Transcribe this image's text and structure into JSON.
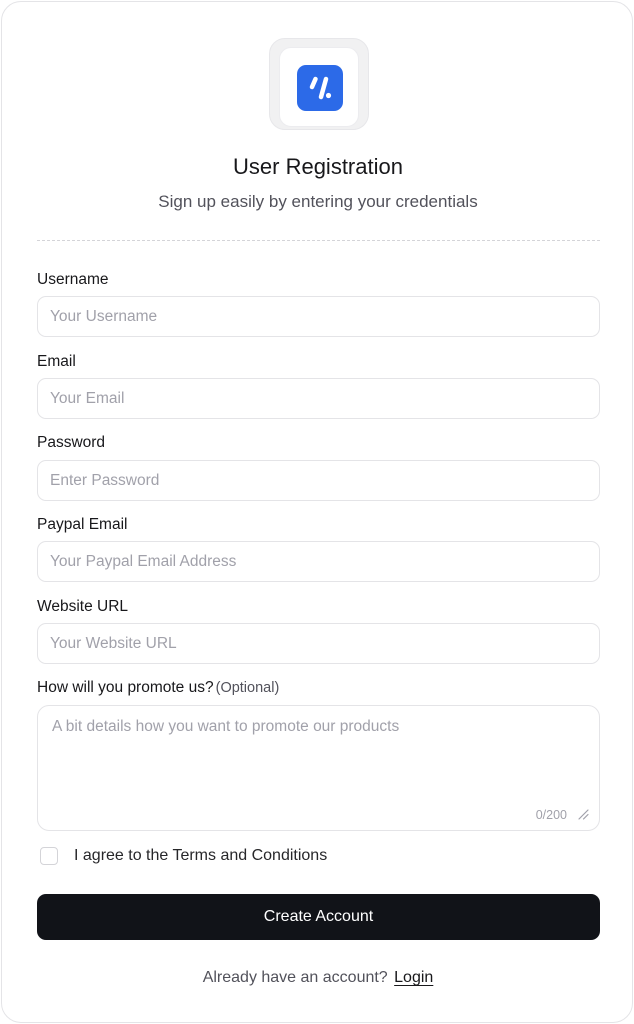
{
  "header": {
    "logo_icon": "brand-logo-icon",
    "brand_color": "#2c6ae8",
    "title": "User Registration",
    "subtitle": "Sign up easily by entering your credentials"
  },
  "form": {
    "username": {
      "label": "Username",
      "placeholder": "Your Username",
      "value": ""
    },
    "email": {
      "label": "Email",
      "placeholder": "Your Email",
      "value": ""
    },
    "password": {
      "label": "Password",
      "placeholder": "Enter Password",
      "value": ""
    },
    "paypal_email": {
      "label": "Paypal Email",
      "placeholder": "Your Paypal Email Address",
      "value": ""
    },
    "website_url": {
      "label": "Website URL",
      "placeholder": "Your Website URL",
      "value": ""
    },
    "promotion": {
      "label": "How will you promote us?",
      "optional": "(Optional)",
      "placeholder": "A bit details how you want to promote our products",
      "counter": "0/200",
      "value": ""
    },
    "terms": {
      "label": "I agree to the Terms and Conditions",
      "checked": false
    },
    "submit_label": "Create Account",
    "submit_color": "#111318"
  },
  "footer": {
    "prompt": "Already have an account?",
    "login_link": "Login"
  }
}
